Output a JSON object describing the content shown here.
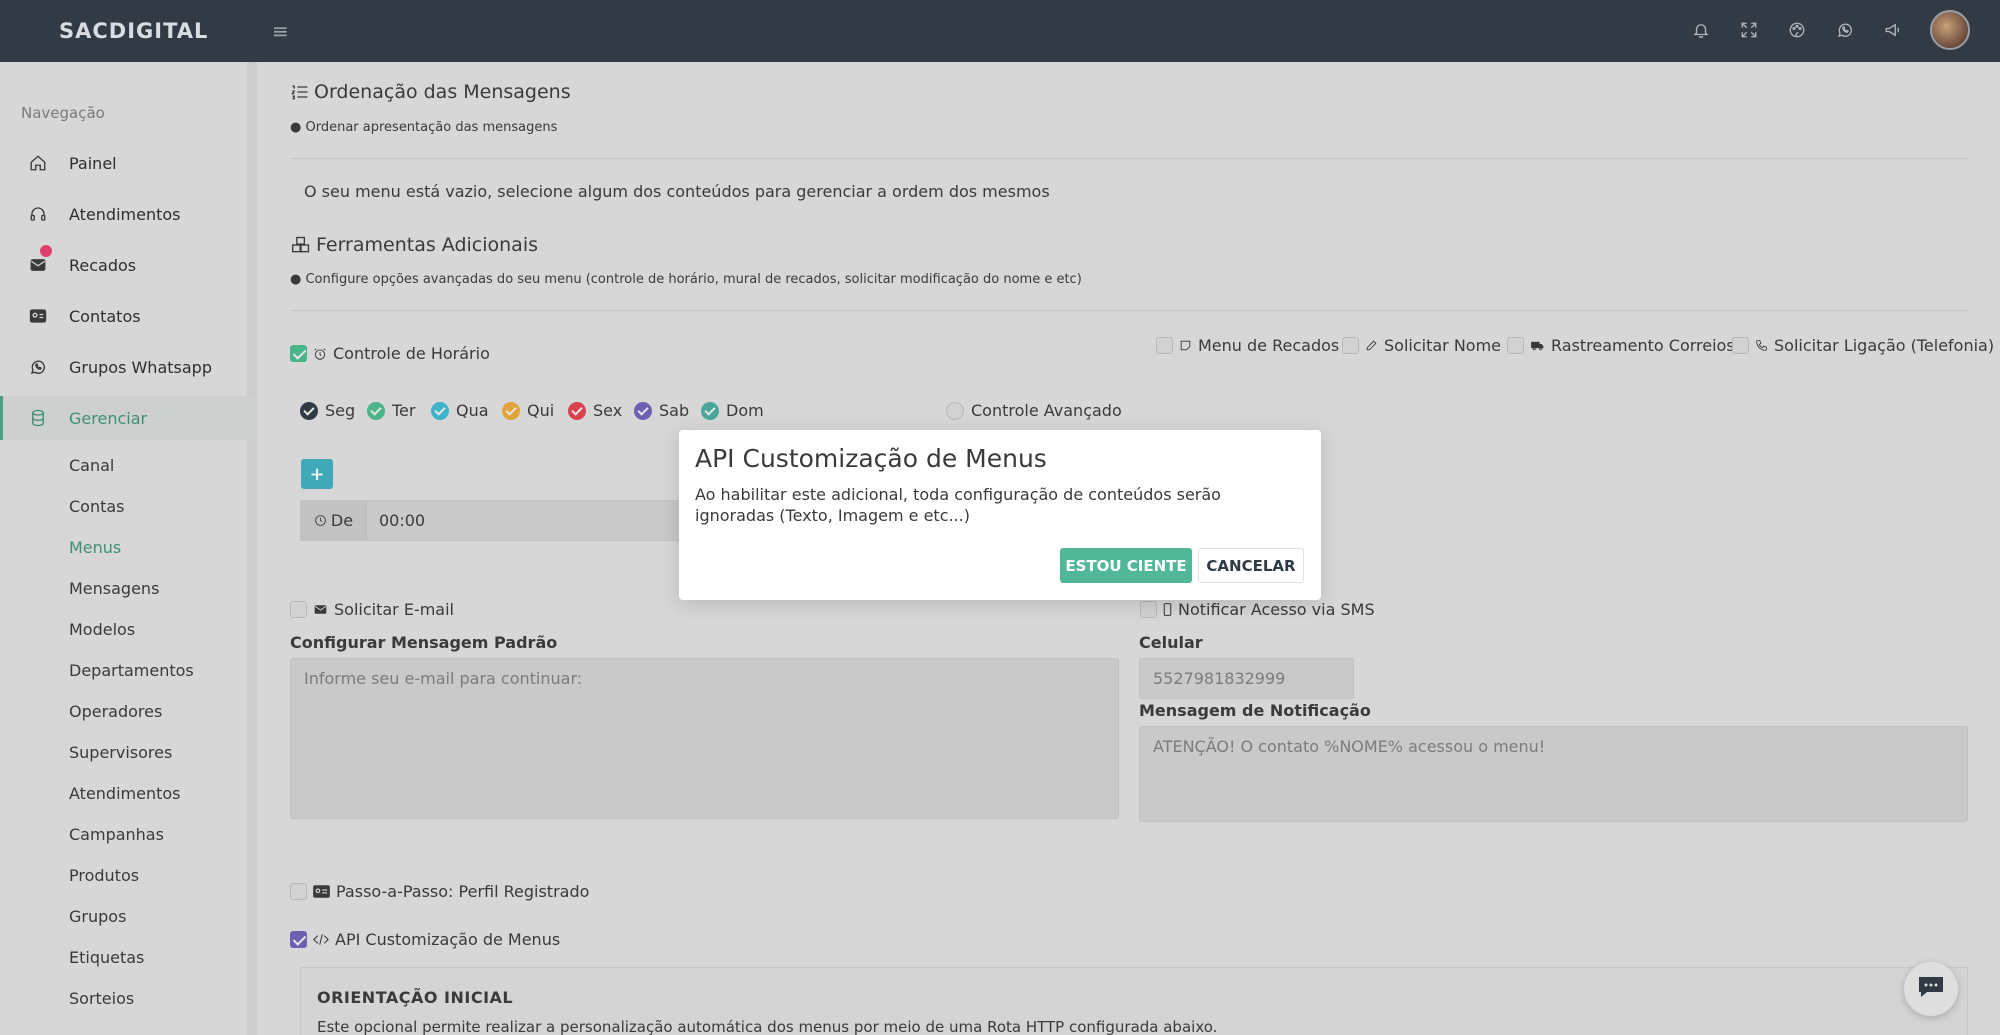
{
  "topbar": {
    "brand": "SACDIGITAL",
    "icons": [
      "hamburger-icon",
      "bell-icon",
      "fullscreen-icon",
      "palette-icon",
      "whatsapp-icon",
      "megaphone-icon"
    ]
  },
  "sidebar": {
    "title": "Navegação",
    "items": [
      {
        "label": "Painel",
        "icon": "home-icon"
      },
      {
        "label": "Atendimentos",
        "icon": "headset-icon"
      },
      {
        "label": "Recados",
        "icon": "mail-icon"
      },
      {
        "label": "Contatos",
        "icon": "contact-card-icon"
      },
      {
        "label": "Grupos Whatsapp",
        "icon": "whatsapp-icon"
      },
      {
        "label": "Gerenciar",
        "icon": "database-icon"
      }
    ],
    "sub_items": [
      "Canal",
      "Contas",
      "Menus",
      "Mensagens",
      "Modelos",
      "Departamentos",
      "Operadores",
      "Supervisores",
      "Atendimentos",
      "Campanhas",
      "Produtos",
      "Grupos",
      "Etiquetas",
      "Sorteios"
    ],
    "active_sub": "Menus"
  },
  "ordering": {
    "title": "Ordenação das Mensagens",
    "subtitle": "Ordenar apresentação das mensagens",
    "empty_text": "O seu menu está vazio, selecione algum dos conteúdos para gerenciar a ordem dos mesmos"
  },
  "tools": {
    "title": "Ferramentas Adicionais",
    "subtitle": "Configure opções avançadas do seu menu (controle de horário, mural de recados, solicitar modificação do nome e etc)",
    "schedule_control": "Controle de Horário",
    "options": [
      "Menu de Recados",
      "Solicitar Nome",
      "Rastreamento Correios",
      "Solicitar Ligação (Telefonia)"
    ],
    "days": [
      {
        "label": "Seg",
        "color": "#2f3a45"
      },
      {
        "label": "Ter",
        "color": "#4bb58a"
      },
      {
        "label": "Qua",
        "color": "#3fb3c9"
      },
      {
        "label": "Qui",
        "color": "#e3a53a"
      },
      {
        "label": "Sex",
        "color": "#d8434f"
      },
      {
        "label": "Sab",
        "color": "#6f5fb0"
      },
      {
        "label": "Dom",
        "color": "#4aa69a"
      }
    ],
    "advanced_control": "Controle Avançado",
    "time_prefix": "De",
    "time_value": "00:00"
  },
  "email": {
    "label": "Solicitar E-mail",
    "field_label": "Configurar Mensagem Padrão",
    "placeholder": "Informe seu e-mail para continuar:"
  },
  "sms": {
    "label": "Notificar Acesso via SMS",
    "phone_label": "Celular",
    "phone_value": "5527981832999",
    "message_label": "Mensagem de Notificação",
    "message_value": "ATENÇÃO! O contato %NOME% acessou o menu!"
  },
  "step": {
    "label": "Passo-a-Passo: Perfil Registrado"
  },
  "api": {
    "label": "API Customização de Menus",
    "card_title": "ORIENTAÇÃO INICIAL",
    "card_text": "Este opcional permite realizar a personalização automática dos menus por meio de uma Rota HTTP configurada abaixo."
  },
  "modal": {
    "title": "API Customização de Menus",
    "body": "Ao habilitar este adicional, toda configuração de conteúdos serão ignoradas (Texto, Imagem e etc...)",
    "ok": "ESTOU CIENTE",
    "cancel": "CANCELAR"
  },
  "colors": {
    "accent": "#48a087",
    "topbar": "#323a45",
    "ok_button": "#51b799",
    "badge": "#e0406b"
  }
}
